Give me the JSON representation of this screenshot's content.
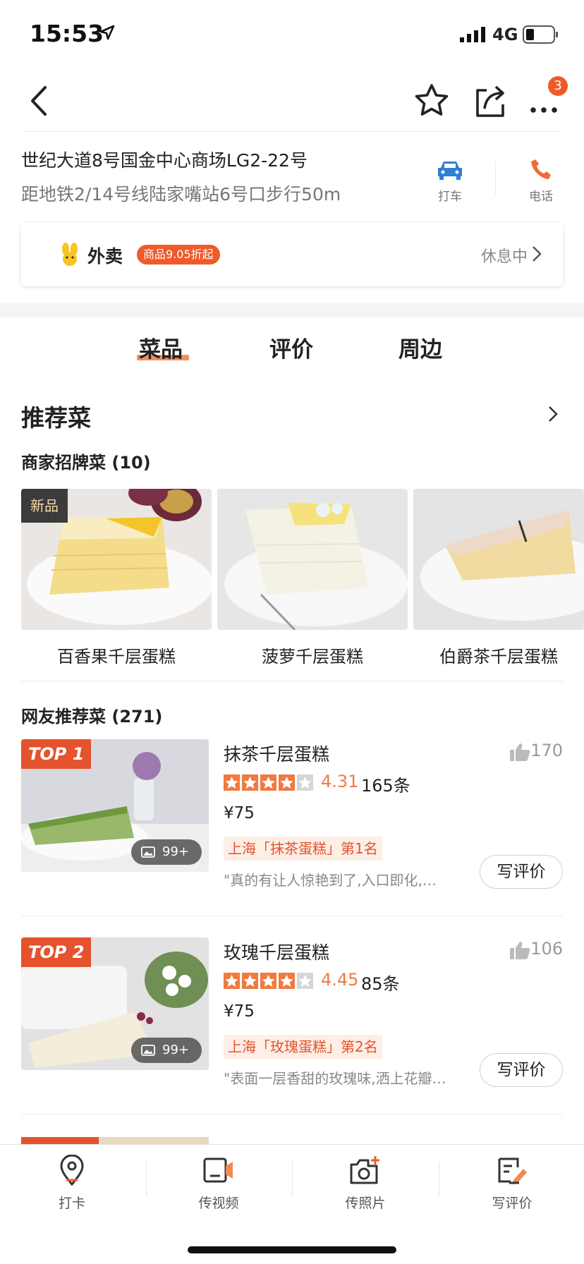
{
  "status_bar": {
    "time": "15:53",
    "network": "4G"
  },
  "navbar": {
    "more_badge": "3"
  },
  "shop": {
    "address": "世纪大道8号国金中心商场LG2-22号",
    "metro": "距地铁2/14号线陆家嘴站6号口步行50m",
    "taxi_label": "打车",
    "phone_label": "电话"
  },
  "takeaway": {
    "name": "外卖",
    "promo": "商品9.05折起",
    "status": "休息中"
  },
  "tabs": [
    {
      "label": "菜品"
    },
    {
      "label": "评价"
    },
    {
      "label": "周边"
    }
  ],
  "recommend": {
    "title": "推荐菜",
    "signature_header": "商家招牌菜 (10)",
    "new_tag": "新品",
    "signature_dishes": [
      {
        "name": "百香果千层蛋糕"
      },
      {
        "name": "菠萝千层蛋糕"
      },
      {
        "name": "伯爵茶千层蛋糕"
      }
    ],
    "user_header": "网友推荐菜 (271)",
    "user_dishes": [
      {
        "top": "TOP 1",
        "name": "抹茶千层蛋糕",
        "likes": "170",
        "rating": 4.31,
        "score": "4.31",
        "reviews": "165条",
        "price": "¥75",
        "rank": "上海「抹茶蛋糕」第1名",
        "quote": "\"真的有让人惊艳到了,入口即化,…",
        "photos": "99+",
        "button": "写评价"
      },
      {
        "top": "TOP 2",
        "name": "玫瑰千层蛋糕",
        "likes": "106",
        "rating": 4.45,
        "score": "4.45",
        "reviews": "85条",
        "price": "¥75",
        "rank": "上海「玫瑰蛋糕」第2名",
        "quote": "\"表面一层香甜的玫瑰味,洒上花瓣…",
        "photos": "99+",
        "button": "写评价"
      }
    ]
  },
  "bottom_bar": [
    {
      "label": "打卡",
      "icon": "location-pin-icon"
    },
    {
      "label": "传视频",
      "icon": "video-upload-icon"
    },
    {
      "label": "传照片",
      "icon": "camera-upload-icon"
    },
    {
      "label": "写评价",
      "icon": "write-review-icon"
    }
  ],
  "colors": {
    "accent": "#f05a2a",
    "star": "#f07a40",
    "rank_bg": "#fdeee6"
  }
}
